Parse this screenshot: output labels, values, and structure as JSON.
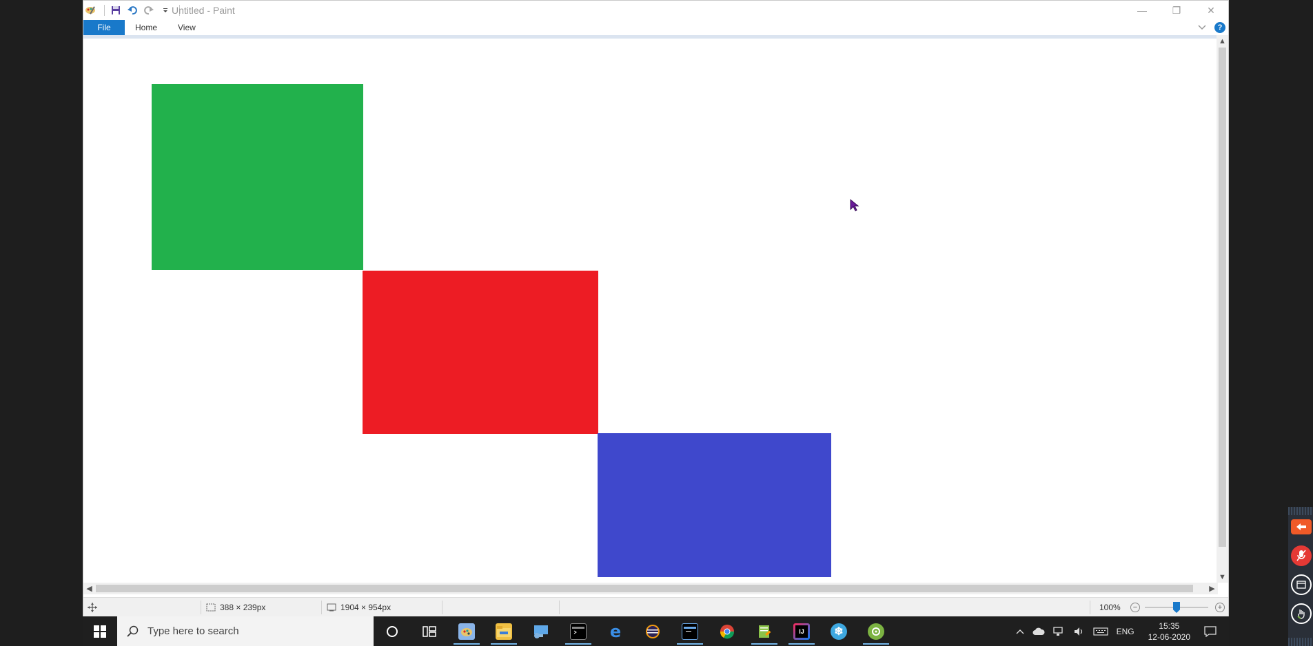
{
  "window": {
    "title": "Untitled - Paint",
    "controls": {
      "minimize": "—",
      "restore": "❐",
      "close": "✕"
    }
  },
  "ribbon": {
    "tabs": [
      {
        "label": "File",
        "active": true
      },
      {
        "label": "Home",
        "active": false
      },
      {
        "label": "View",
        "active": false
      }
    ],
    "help": "?",
    "accent_color": "#1979ca"
  },
  "canvas": {
    "background": "#ffffff",
    "shapes": [
      {
        "name": "green-rectangle",
        "color": "#22b14c"
      },
      {
        "name": "red-rectangle",
        "color": "#ed1c24"
      },
      {
        "name": "blue-rectangle",
        "color": "#3f48cc"
      }
    ]
  },
  "statusbar": {
    "selection_size": "388 × 239px",
    "canvas_size": "1904 × 954px",
    "zoom": "100%",
    "zoom_out": "−",
    "zoom_in": "+"
  },
  "taskbar": {
    "search_placeholder": "Type here to search",
    "pinned_apps": [
      {
        "name": "cortana",
        "label": "O"
      },
      {
        "name": "task-view",
        "label": "⊟"
      },
      {
        "name": "paint",
        "label": "🎨"
      },
      {
        "name": "file-explorer",
        "label": "📁"
      },
      {
        "name": "remote-desktop",
        "label": "🖥"
      },
      {
        "name": "terminal",
        "label": ">_"
      },
      {
        "name": "edge",
        "label": "e"
      },
      {
        "name": "eclipse",
        "label": "◐"
      },
      {
        "name": "cmd",
        "label": "▭"
      },
      {
        "name": "chrome",
        "label": "◉"
      },
      {
        "name": "notepad-plus",
        "label": "✎"
      },
      {
        "name": "intellij",
        "label": "IJ"
      },
      {
        "name": "snowflake-app",
        "label": "❄"
      },
      {
        "name": "android-studio",
        "label": "⚙"
      }
    ],
    "tray": {
      "language": "ENG",
      "time": "15:35",
      "date": "12-06-2020"
    }
  }
}
